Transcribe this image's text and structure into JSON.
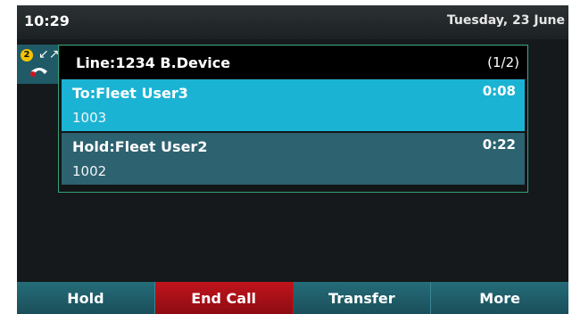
{
  "status": {
    "time": "10:29",
    "date": "Tuesday, 23 June"
  },
  "line_key": {
    "badge": "2",
    "icon": "phone-handset-icon",
    "arrows": "↙↗"
  },
  "call_panel": {
    "title": "Line:1234 B.Device",
    "count": "(1/2)",
    "calls": [
      {
        "label": "To:Fleet User3",
        "number": "1003",
        "timer": "0:08",
        "state": "active"
      },
      {
        "label": "Hold:Fleet User2",
        "number": "1002",
        "timer": "0:22",
        "state": "hold"
      }
    ]
  },
  "softkeys": [
    {
      "label": "Hold"
    },
    {
      "label": "End Call"
    },
    {
      "label": "Transfer"
    },
    {
      "label": "More"
    }
  ],
  "colors": {
    "accent": "#1bb3d4",
    "hold_row": "#2d6270",
    "end_call": "#c0141d",
    "softkey": "#256c79"
  }
}
